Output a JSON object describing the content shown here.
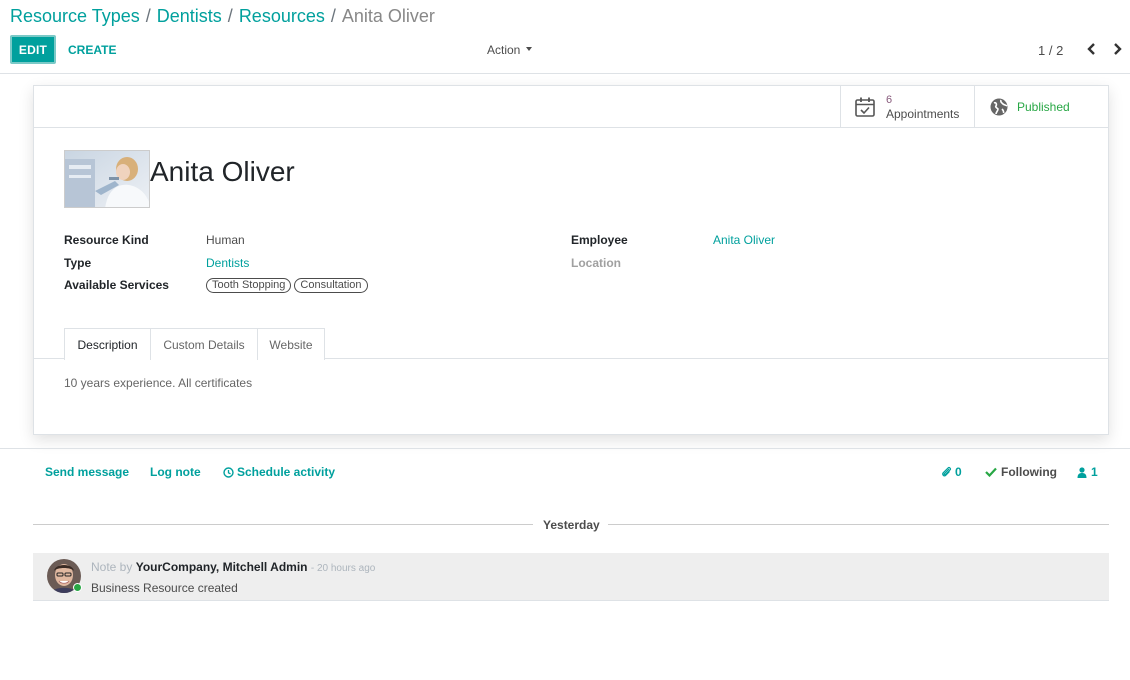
{
  "breadcrumb": {
    "items": [
      "Resource Types",
      "Dentists",
      "Resources"
    ],
    "separator": "/",
    "current": "Anita Oliver"
  },
  "toolbar": {
    "edit_label": "EDIT",
    "create_label": "CREATE",
    "action_label": "Action",
    "pager": "1 / 2"
  },
  "smart_buttons": {
    "appointments_count": "6",
    "appointments_label": "Appointments",
    "published_label": "Published"
  },
  "record": {
    "name": "Anita Oliver"
  },
  "fields": {
    "resource_kind": {
      "label": "Resource Kind",
      "value": "Human"
    },
    "type": {
      "label": "Type",
      "value": "Dentists"
    },
    "available_services": {
      "label": "Available Services",
      "tags": [
        "Tooth Stopping",
        "Consultation"
      ]
    },
    "employee": {
      "label": "Employee",
      "value": "Anita Oliver"
    },
    "location": {
      "label": "Location",
      "value": ""
    }
  },
  "tabs": [
    {
      "label": "Description",
      "active": true
    },
    {
      "label": "Custom Details",
      "active": false
    },
    {
      "label": "Website",
      "active": false
    }
  ],
  "description_text": "10 years experience. All certificates",
  "chatter": {
    "send_message": "Send message",
    "log_note": "Log note",
    "schedule_activity": "Schedule activity",
    "attachments_count": "0",
    "following_label": "Following",
    "followers_count": "1",
    "date_divider": "Yesterday",
    "message": {
      "kind": "Note by",
      "author": "YourCompany, Mitchell Admin",
      "time": "- 20 hours ago",
      "body": "Business Resource created"
    }
  },
  "colors": {
    "primary": "#00a09d",
    "smart_number": "#875a7b",
    "published": "#28a745",
    "online": "#28a745"
  }
}
